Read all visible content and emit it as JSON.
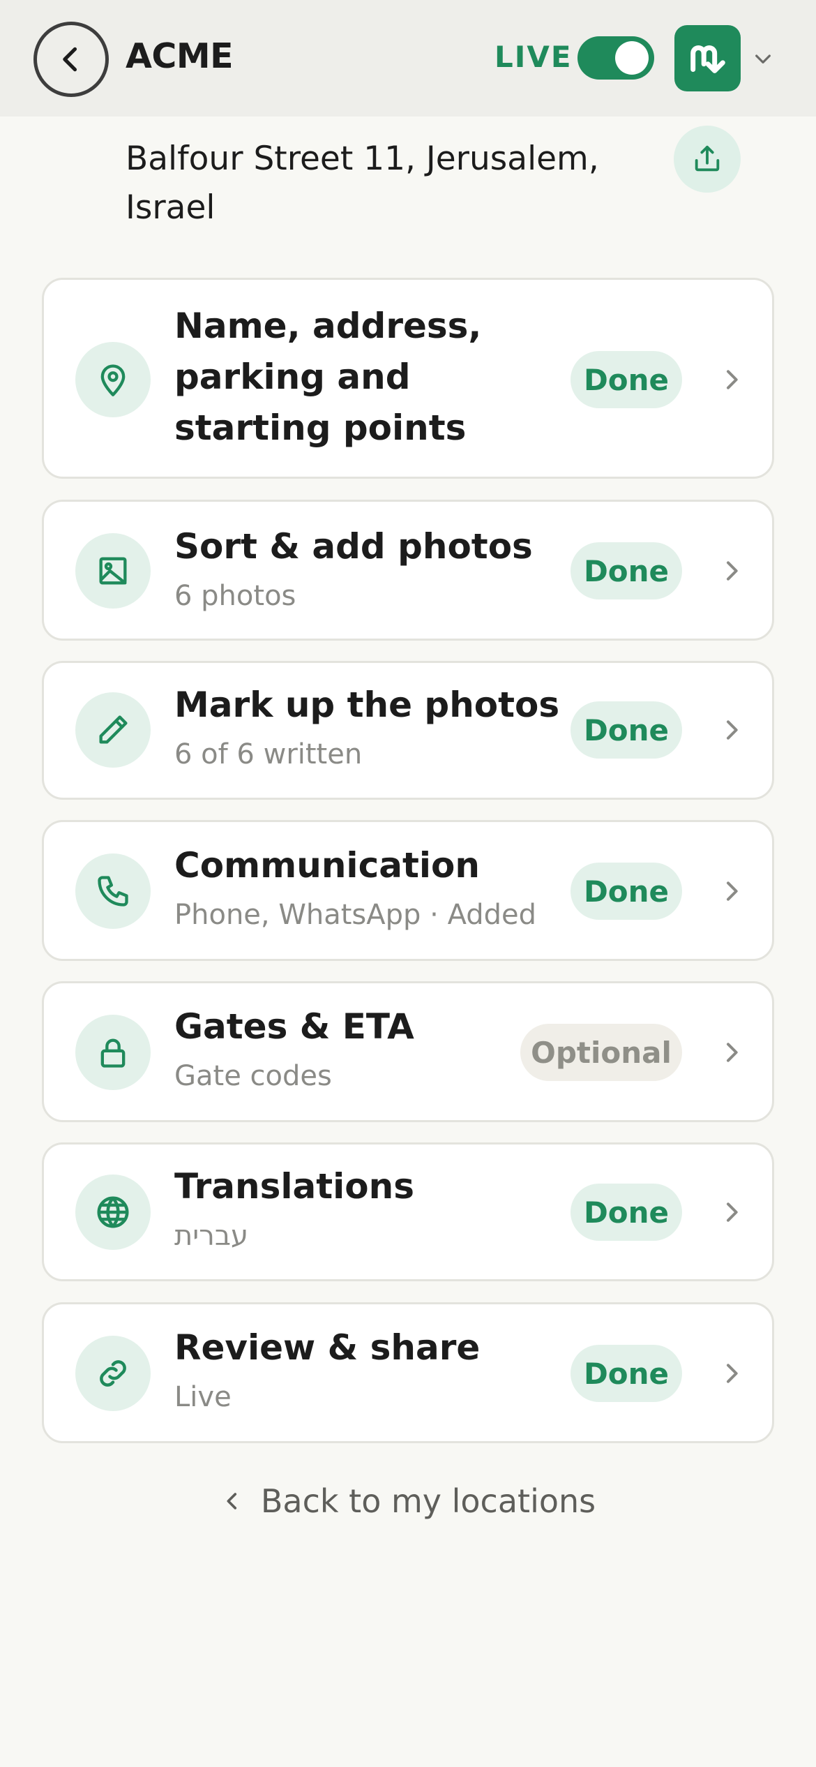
{
  "header": {
    "brand": "ACME",
    "live_label": "LIVE",
    "live_enabled": true,
    "accent_color": "#1f8a5b"
  },
  "location": {
    "address": "Balfour Street 11, Jerusalem, Israel"
  },
  "steps": [
    {
      "icon": "map-pin-icon",
      "title": "Name, address, parking and starting points",
      "subtitle": "",
      "status": "Done"
    },
    {
      "icon": "image-icon",
      "title": "Sort & add photos",
      "subtitle": "6 photos",
      "status": "Done"
    },
    {
      "icon": "pencil-icon",
      "title": "Mark up the photos",
      "subtitle": "6 of 6 written",
      "status": "Done"
    },
    {
      "icon": "phone-icon",
      "title": "Communication",
      "subtitle": "Phone, WhatsApp · Added",
      "status": "Done"
    },
    {
      "icon": "lock-icon",
      "title": "Gates & ETA",
      "subtitle": "Gate codes",
      "status": "Optional"
    },
    {
      "icon": "globe-icon",
      "title": "Translations",
      "subtitle": "עברית",
      "status": "Done"
    },
    {
      "icon": "link-icon",
      "title": "Review & share",
      "subtitle": "Live",
      "status": "Done"
    }
  ],
  "footer": {
    "back_label": "Back to my locations"
  }
}
